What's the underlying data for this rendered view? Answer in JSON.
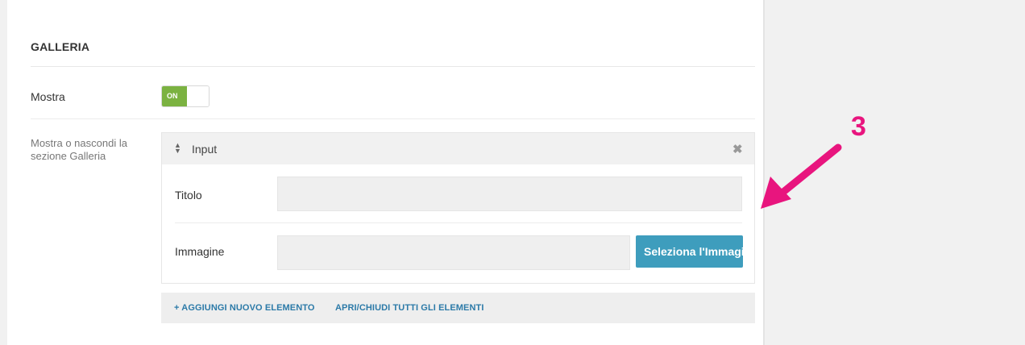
{
  "section": {
    "title": "GALLERIA"
  },
  "show": {
    "label": "Mostra",
    "toggle_text": "ON",
    "description": "Mostra o nascondi la sezione Galleria"
  },
  "item": {
    "header": "Input",
    "fields": {
      "title_label": "Titolo",
      "title_value": "",
      "image_label": "Immagine",
      "image_value": "",
      "select_button": "Seleziona l'Immagine"
    }
  },
  "actions": {
    "add": "+ AGGIUNGI NUOVO ELEMENTO",
    "toggle_all": "APRI/CHIUDI TUTTI GLI ELEMENTI"
  },
  "annotation": {
    "number": "3",
    "color": "#e8157e"
  },
  "icons": {
    "sort": "sort-icon",
    "close": "close-icon",
    "arrow": "arrow-icon"
  },
  "colors": {
    "toggle_on": "#7bb241",
    "button": "#3e9dbd",
    "link": "#2c7aa8"
  }
}
